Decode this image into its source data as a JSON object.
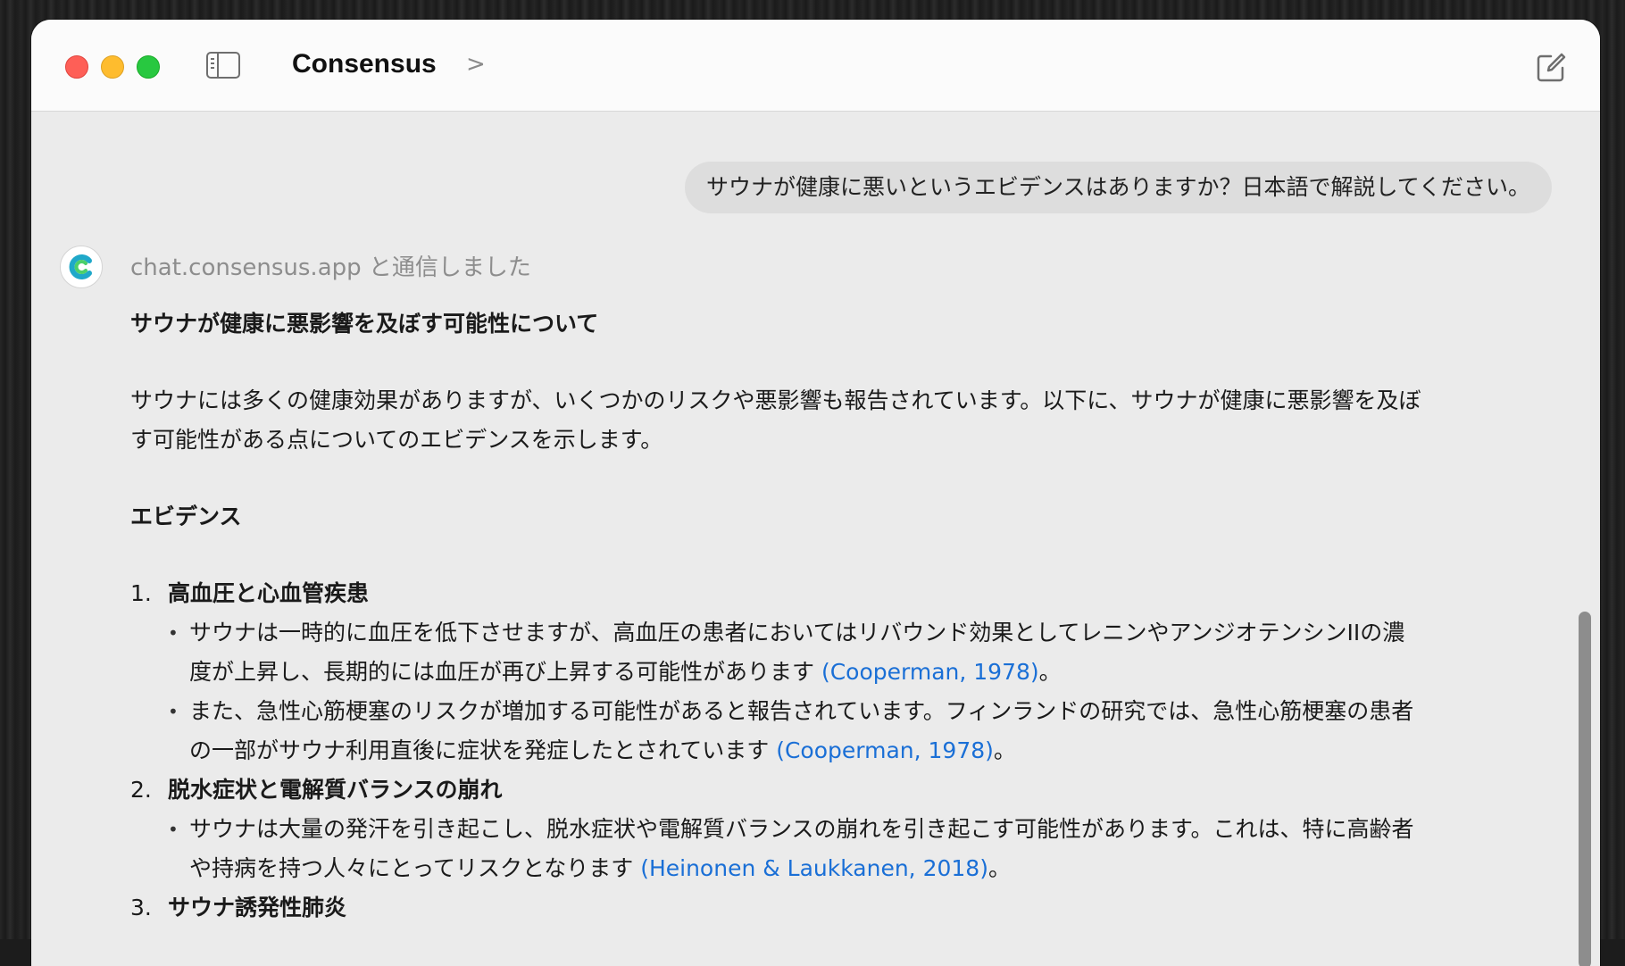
{
  "window": {
    "title": "Consensus",
    "title_chevron": ">"
  },
  "user_message": "サウナが健康に悪いというエビデンスはありますか？日本語で解説してください。",
  "assistant": {
    "tool_status": "chat.consensus.app と通信しました",
    "heading": "サウナが健康に悪影響を及ぼす可能性について",
    "intro_line1": "サウナには多くの健康効果がありますが、いくつかのリスクや悪影響も報告されています。以下に、サウナが健康に悪影響を及ぼ",
    "intro_line2": "す可能性がある点についてのエビデンスを示します。",
    "section_heading": "エビデンス",
    "items": [
      {
        "number": "1.",
        "title": "高血圧と心血管疾患",
        "bullets": [
          {
            "line1": "サウナは一時的に血圧を低下させますが、高血圧の患者においてはリバウンド効果としてレニンやアンジオテンシンIIの濃",
            "line2": "度が上昇し、長期的には血圧が再び上昇する可能性があります ",
            "cite": "(Cooperman, 1978)",
            "end": "。"
          },
          {
            "line1": "また、急性心筋梗塞のリスクが増加する可能性があると報告されています。フィンランドの研究では、急性心筋梗塞の患者",
            "line2": "の一部がサウナ利用直後に症状を発症したとされています ",
            "cite": "(Cooperman, 1978)",
            "end": "。"
          }
        ]
      },
      {
        "number": "2.",
        "title": "脱水症状と電解質バランスの崩れ",
        "bullets": [
          {
            "line1": "サウナは大量の発汗を引き起こし、脱水症状や電解質バランスの崩れを引き起こす可能性があります。これは、特に高齢者",
            "line2": "や持病を持つ人々にとってリスクとなります ",
            "cite": "(Heinonen & Laukkanen, 2018)",
            "end": "。"
          }
        ]
      },
      {
        "number": "3.",
        "title": "サウナ誘発性肺炎",
        "bullets": []
      }
    ]
  },
  "colors": {
    "accent_link": "#1a6fd6",
    "close": "#fe5f57",
    "minimize": "#febc2e",
    "maximize": "#28c840"
  }
}
